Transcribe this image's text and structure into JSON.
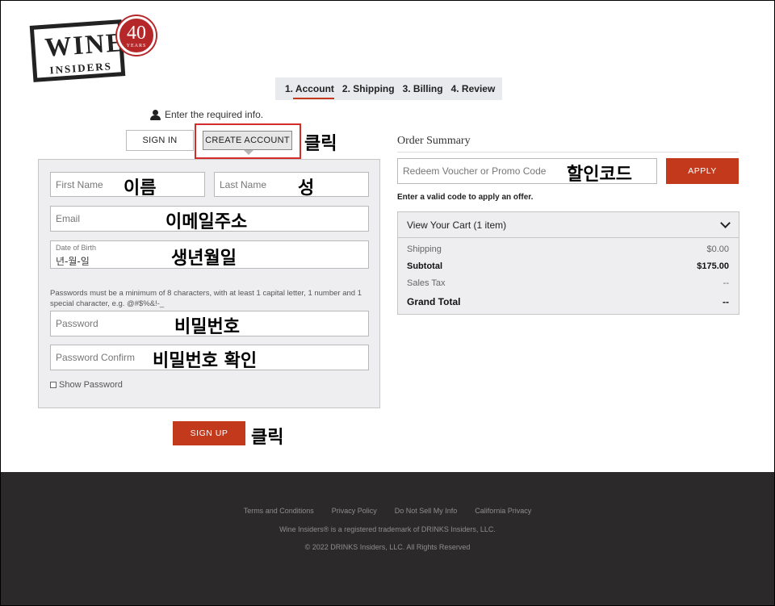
{
  "logo": {
    "brand": "WINE",
    "sub": "INSIDERS",
    "badge_num": "40",
    "badge_text": "YEARS"
  },
  "steps": [
    {
      "label": "1. Account"
    },
    {
      "label": "2. Shipping"
    },
    {
      "label": "3. Billing"
    },
    {
      "label": "4. Review"
    }
  ],
  "account": {
    "required_info": "Enter the required info.",
    "tab_signin": "SIGN IN",
    "tab_create": "CREATE ACCOUNT",
    "first_name_placeholder": "First Name",
    "last_name_placeholder": "Last Name",
    "email_placeholder": "Email",
    "dob_label": "Date of Birth",
    "dob_value": "년-월-일",
    "password_hint": "Passwords must be a minimum of 8 characters, with at least 1 capital letter, 1 number and 1 special character, e.g. @#$%&!-_",
    "password_placeholder": "Password",
    "password_confirm_placeholder": "Password Confirm",
    "show_password": "Show Password",
    "signup": "SIGN UP"
  },
  "annotations": {
    "click1": "클릭",
    "first_name": "이름",
    "last_name": "성",
    "email": "이메일주소",
    "dob": "생년월일",
    "password": "비밀번호",
    "password_confirm": "비밀번호 확인",
    "promo": "할인코드",
    "click2": "클릭"
  },
  "summary": {
    "title": "Order Summary",
    "promo_placeholder": "Redeem Voucher or Promo Code",
    "apply": "APPLY",
    "valid_note": "Enter a valid code to apply an offer.",
    "cart_title": "View Your Cart (1 item)",
    "rows": [
      {
        "label": "Shipping",
        "value": "$0.00"
      },
      {
        "label": "Subtotal",
        "value": "$175.00"
      },
      {
        "label": "Sales Tax",
        "value": "--"
      },
      {
        "label": "Grand Total",
        "value": "--"
      }
    ]
  },
  "footer": {
    "links": [
      "Terms and Conditions",
      "Privacy Policy",
      "Do Not Sell My Info",
      "California Privacy"
    ],
    "trademark": "Wine Insiders® is a registered trademark of DRINKS Insiders, LLC.",
    "copyright": "© 2022 DRINKS Insiders, LLC. All Rights Reserved"
  },
  "colors": {
    "accent": "#c2391b",
    "badge": "#b6272a",
    "footer_bg": "#2b292a",
    "highlight": "#d42b2b"
  }
}
